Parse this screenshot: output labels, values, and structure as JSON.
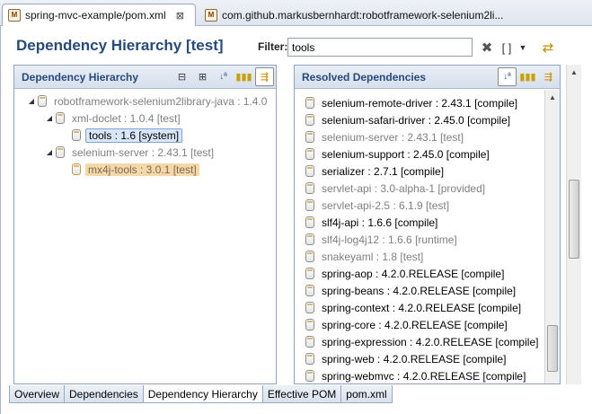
{
  "editor_tabs": [
    {
      "label": "spring-mvc-example/pom.xml",
      "close": "⊠"
    },
    {
      "label": "com.github.markusbernhardt:robotframework-selenium2li..."
    }
  ],
  "header": {
    "title": "Dependency Hierarchy [test]",
    "filter_label": "Filter:",
    "filter_value": "tools"
  },
  "left_pane": {
    "title": "Dependency Hierarchy",
    "tree": [
      {
        "label": "robotframework-selenium2library-java : 1.4.0"
      },
      {
        "label": "xml-doclet : 1.0.4 [test]"
      },
      {
        "label": "tools : 1.6 [system]"
      },
      {
        "label": "selenium-server : 2.43.1 [test]"
      },
      {
        "label": "mx4j-tools : 3.0.1 [test]"
      }
    ]
  },
  "right_pane": {
    "title": "Resolved Dependencies",
    "items": [
      {
        "label": "selenium-remote-driver : 2.43.1 [compile]"
      },
      {
        "label": "selenium-safari-driver : 2.45.0 [compile]"
      },
      {
        "label": "selenium-server : 2.43.1 [test]"
      },
      {
        "label": "selenium-support : 2.45.0 [compile]"
      },
      {
        "label": "serializer : 2.7.1 [compile]"
      },
      {
        "label": "servlet-api : 3.0-alpha-1 [provided]"
      },
      {
        "label": "servlet-api-2.5 : 6.1.9 [test]"
      },
      {
        "label": "slf4j-api : 1.6.6 [compile]"
      },
      {
        "label": "slf4j-log4j12 : 1.6.6 [runtime]"
      },
      {
        "label": "snakeyaml : 1.8 [test]"
      },
      {
        "label": "spring-aop : 4.2.0.RELEASE [compile]"
      },
      {
        "label": "spring-beans : 4.2.0.RELEASE [compile]"
      },
      {
        "label": "spring-context : 4.2.0.RELEASE [compile]"
      },
      {
        "label": "spring-core : 4.2.0.RELEASE [compile]"
      },
      {
        "label": "spring-expression : 4.2.0.RELEASE [compile]"
      },
      {
        "label": "spring-web : 4.2.0.RELEASE [compile]"
      },
      {
        "label": "spring-webmvc : 4.2.0.RELEASE [compile]"
      }
    ]
  },
  "page_tabs": [
    "Overview",
    "Dependencies",
    "Dependency Hierarchy",
    "Effective POM",
    "pom.xml"
  ],
  "colors": {
    "title": "#274a7c",
    "selection_blue": "#d9e6f7",
    "selection_orange": "#f6d8a8"
  }
}
